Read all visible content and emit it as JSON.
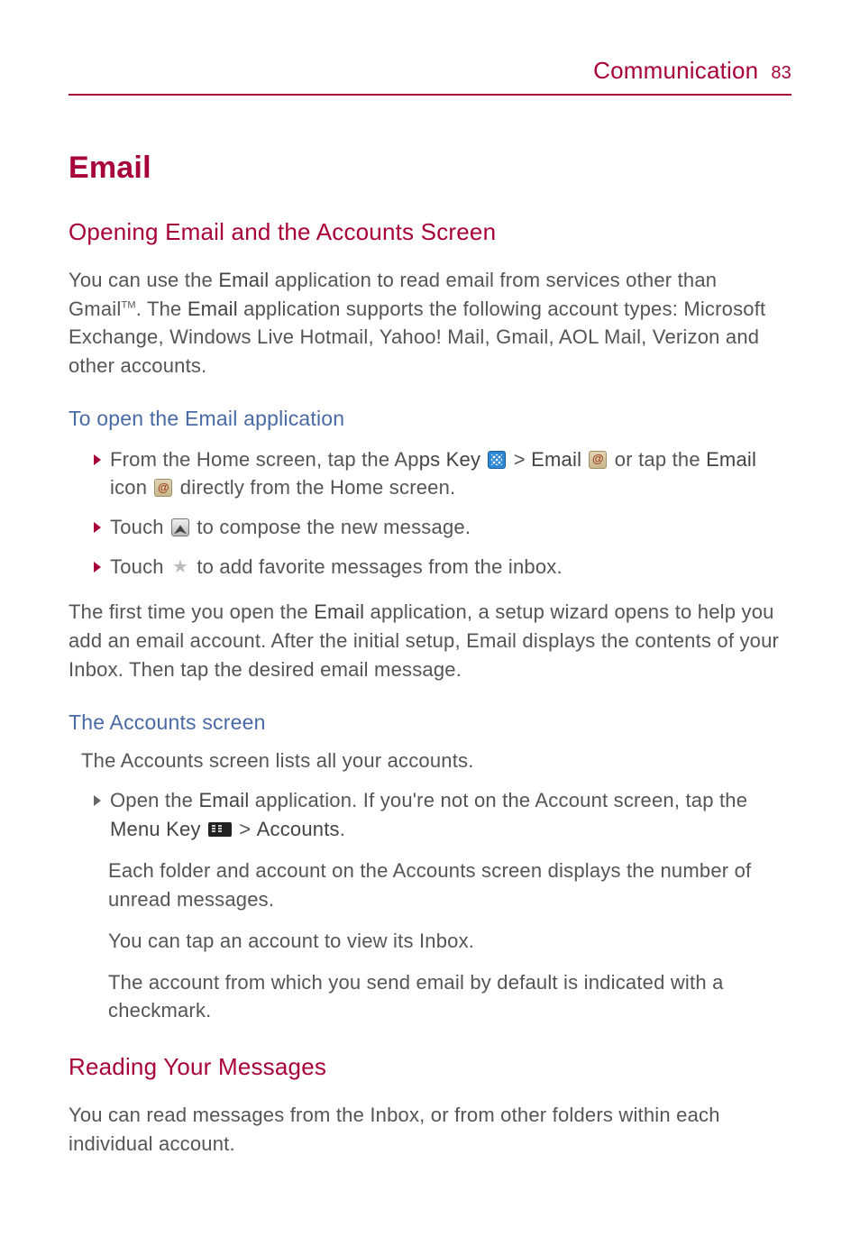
{
  "header": {
    "section": "Communication",
    "page": "83"
  },
  "title": "Email",
  "h2a": "Opening Email and the Accounts Screen",
  "intro": {
    "p1a": "You can use the ",
    "p1b": "Email",
    "p1c": " application to read email from services other than Gmail",
    "p1d": ". The ",
    "p1e": "Email",
    "p1f": " application supports the following account types: Microsoft Exchange, Windows Live Hotmail, Yahoo! Mail, Gmail, AOL Mail, Verizon and other accounts.",
    "tm": "TM"
  },
  "h3a": "To open the Email application",
  "b1": {
    "a": "From the Home screen, tap the Ap",
    "b": "ps Key",
    "c": " > ",
    "d": "Email",
    "e": " or tap the ",
    "f": "Email",
    "g": " icon ",
    "h": " directly from the Home screen."
  },
  "b2": {
    "a": "Touch ",
    "b": " to compose the new message."
  },
  "b3": {
    "a": "Touch ",
    "b": " to add favorite messages from the inbox."
  },
  "para2": {
    "a": "The first time you open the ",
    "b": "Email",
    "c": " application, a setup wizard opens to help you add an email account. After the initial setup, Email displays the contents of your Inbox. Then tap the desired email message."
  },
  "h3b": "The Accounts screen",
  "acc_intro": "The Accounts screen lists all your accounts.",
  "acc_b1": {
    "a": "Open the ",
    "b": "Email",
    "c": " application. If you're not on the Account screen, tap the ",
    "d": "Menu Key",
    "e": " > ",
    "f": "Accounts",
    "g": "."
  },
  "acc_p1": "Each folder and account on the Accounts screen displays the number of unread messages.",
  "acc_p2": "You can tap an account to view its Inbox.",
  "acc_p3": "The account from which you send email by default is indicated with a checkmark.",
  "h2b": "Reading Your Messages",
  "read_p": "You can read messages from the Inbox, or from other folders within each individual account."
}
